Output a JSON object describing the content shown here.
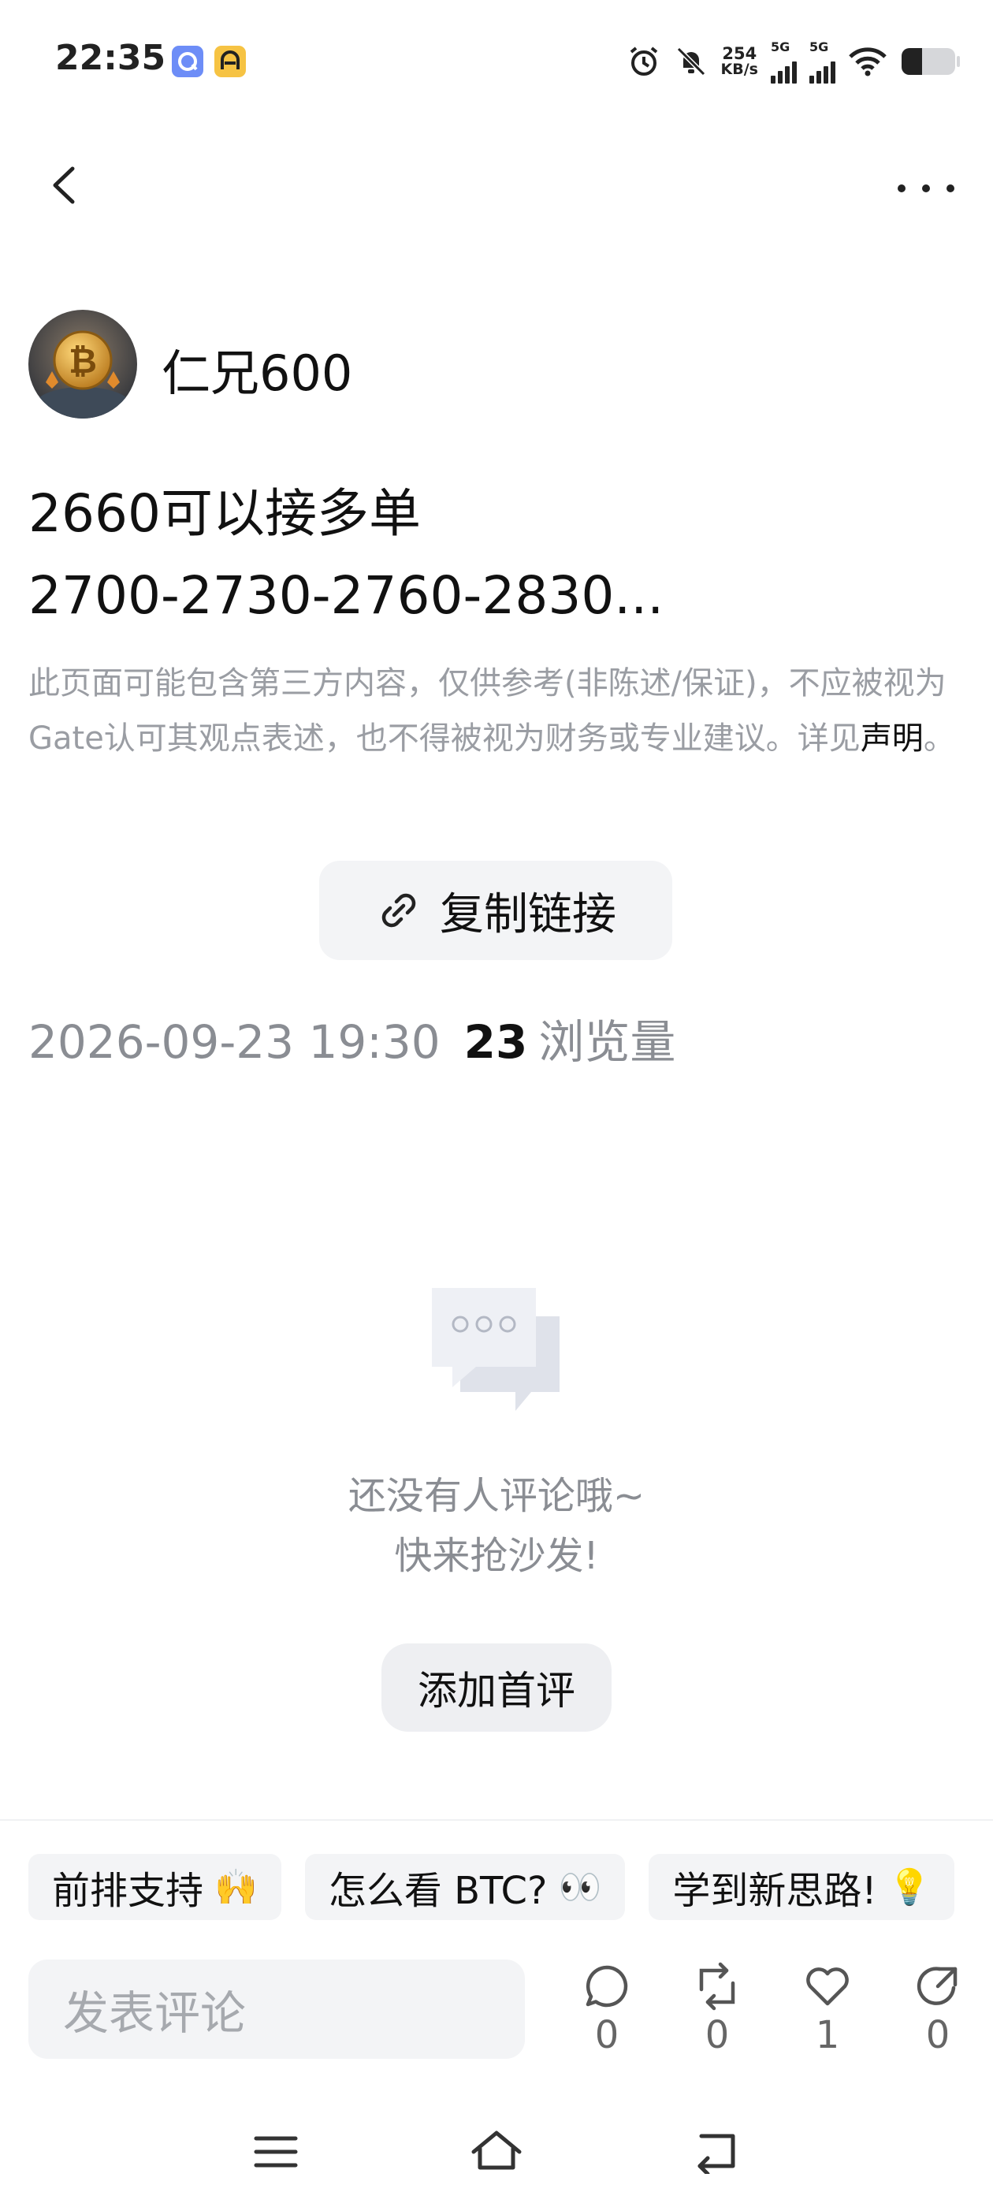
{
  "status_bar": {
    "time": "22:35",
    "net_speed_value": "254",
    "net_speed_unit": "KB/s",
    "signal_1_label": "5G",
    "signal_2_label": "5G"
  },
  "nav": {
    "back_icon": "chevron-left-icon",
    "more_icon": "more-horizontal-icon"
  },
  "author": {
    "name": "仁兄600"
  },
  "post": {
    "line1": "2660可以接多单",
    "line2": "2700-2730-2760-2830..."
  },
  "disclaimer": {
    "text": "此页面可能包含第三方内容，仅供参考(非陈述/保证)，不应被视为Gate认可其观点表述，也不得被视为财务或专业建议。详见",
    "link": "声明",
    "suffix": "。"
  },
  "copy_link": {
    "label": "复制链接",
    "icon": "link-icon"
  },
  "meta": {
    "datetime": "2026-09-23 19:30",
    "views_count": "23",
    "views_label": "浏览量"
  },
  "empty_state": {
    "line1": "还没有人评论哦~",
    "line2": "快来抢沙发!",
    "button": "添加首评"
  },
  "quick_replies": [
    {
      "label": "前排支持",
      "emoji": "🙌"
    },
    {
      "label": "怎么看 BTC?",
      "emoji": "👀"
    },
    {
      "label": "学到新思路!",
      "emoji": "💡"
    }
  ],
  "comment_input": {
    "placeholder": "发表评论"
  },
  "actions": [
    {
      "name": "comment",
      "icon": "comment-icon",
      "count": "0"
    },
    {
      "name": "repost",
      "icon": "repost-icon",
      "count": "0"
    },
    {
      "name": "like",
      "icon": "heart-icon",
      "count": "1"
    },
    {
      "name": "share",
      "icon": "share-icon",
      "count": "0"
    }
  ],
  "colors": {
    "accent_yellow": "#f5c518",
    "muted_text": "#9a9da3",
    "chip_bg": "#f3f4f6"
  }
}
